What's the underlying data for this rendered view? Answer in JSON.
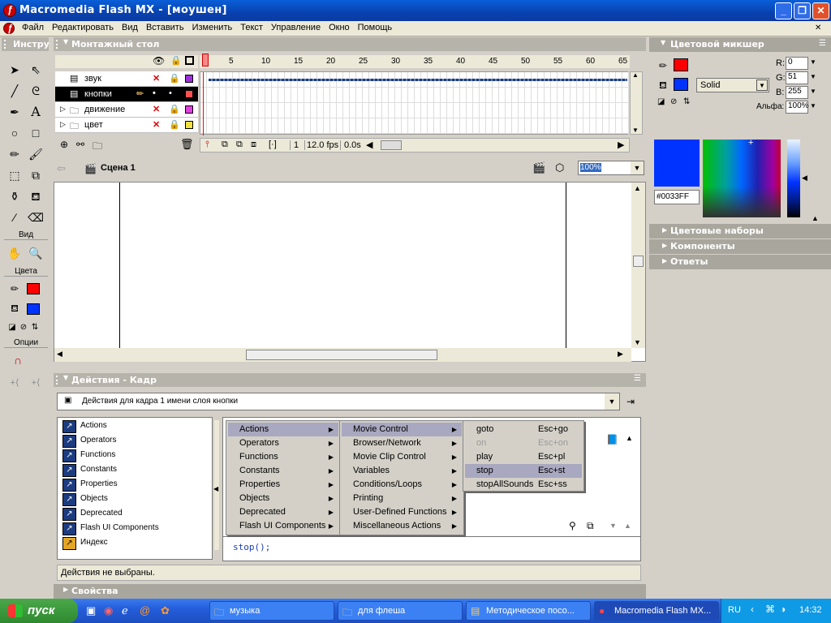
{
  "window": {
    "title": "Macromedia Flash MX - [моушен]"
  },
  "menubar": [
    "Файл",
    "Редактировать",
    "Вид",
    "Вставить",
    "Изменить",
    "Текст",
    "Управление",
    "Окно",
    "Помощь"
  ],
  "tools": {
    "title": "Инстру",
    "view": "Вид",
    "colors": "Цвета",
    "options": "Опции"
  },
  "timeline": {
    "title": "Монтажный стол",
    "ticks": [
      "1",
      "5",
      "10",
      "15",
      "20",
      "25",
      "30",
      "35",
      "40",
      "45",
      "50",
      "55",
      "60",
      "65"
    ],
    "layers": [
      {
        "name": "звук"
      },
      {
        "name": "кнопки",
        "selected": true
      },
      {
        "name": "движение"
      },
      {
        "name": "цвет"
      }
    ],
    "current_frame": "1",
    "fps": "12.0 fps",
    "time": "0.0s"
  },
  "scene": {
    "name": "Сцена 1",
    "zoom": "100%"
  },
  "actions": {
    "title": "Действия - Кадр",
    "frame_label": "Действия для кадра 1 имени слоя кнопки",
    "categories": [
      "Actions",
      "Operators",
      "Functions",
      "Constants",
      "Properties",
      "Objects",
      "Deprecated",
      "Flash UI Components",
      "Индекс"
    ],
    "menu1": [
      "Actions",
      "Operators",
      "Functions",
      "Constants",
      "Properties",
      "Objects",
      "Deprecated",
      "Flash UI Components"
    ],
    "menu2": [
      "Movie Control",
      "Browser/Network",
      "Movie Clip Control",
      "Variables",
      "Conditions/Loops",
      "Printing",
      "User-Defined Functions",
      "Miscellaneous Actions"
    ],
    "menu3": [
      {
        "label": "goto",
        "key": "Esc+go"
      },
      {
        "label": "on",
        "key": "Esc+on"
      },
      {
        "label": "play",
        "key": "Esc+pl"
      },
      {
        "label": "stop",
        "key": "Esc+st"
      },
      {
        "label": "stopAllSounds",
        "key": "Esc+ss"
      }
    ],
    "code": "stop();",
    "status": "Действия не выбраны."
  },
  "properties": {
    "title": "Свойства"
  },
  "mixer": {
    "title": "Цветовой микшер",
    "R": "0",
    "G": "51",
    "B": "255",
    "alpha_label": "Альфа:",
    "alpha": "100%",
    "fill_type": "Solid",
    "hex": "#0033FF",
    "fill_color": "#0033ff",
    "stroke_color": "#ff0000"
  },
  "panels": [
    "Цветовые наборы",
    "Компоненты",
    "Ответы"
  ],
  "taskbar": {
    "start": "пуск",
    "tasks": [
      "музыка",
      "для флеша",
      "Методическое посо...",
      "Macromedia Flash MX..."
    ],
    "lang": "RU",
    "clock": "14:32"
  }
}
